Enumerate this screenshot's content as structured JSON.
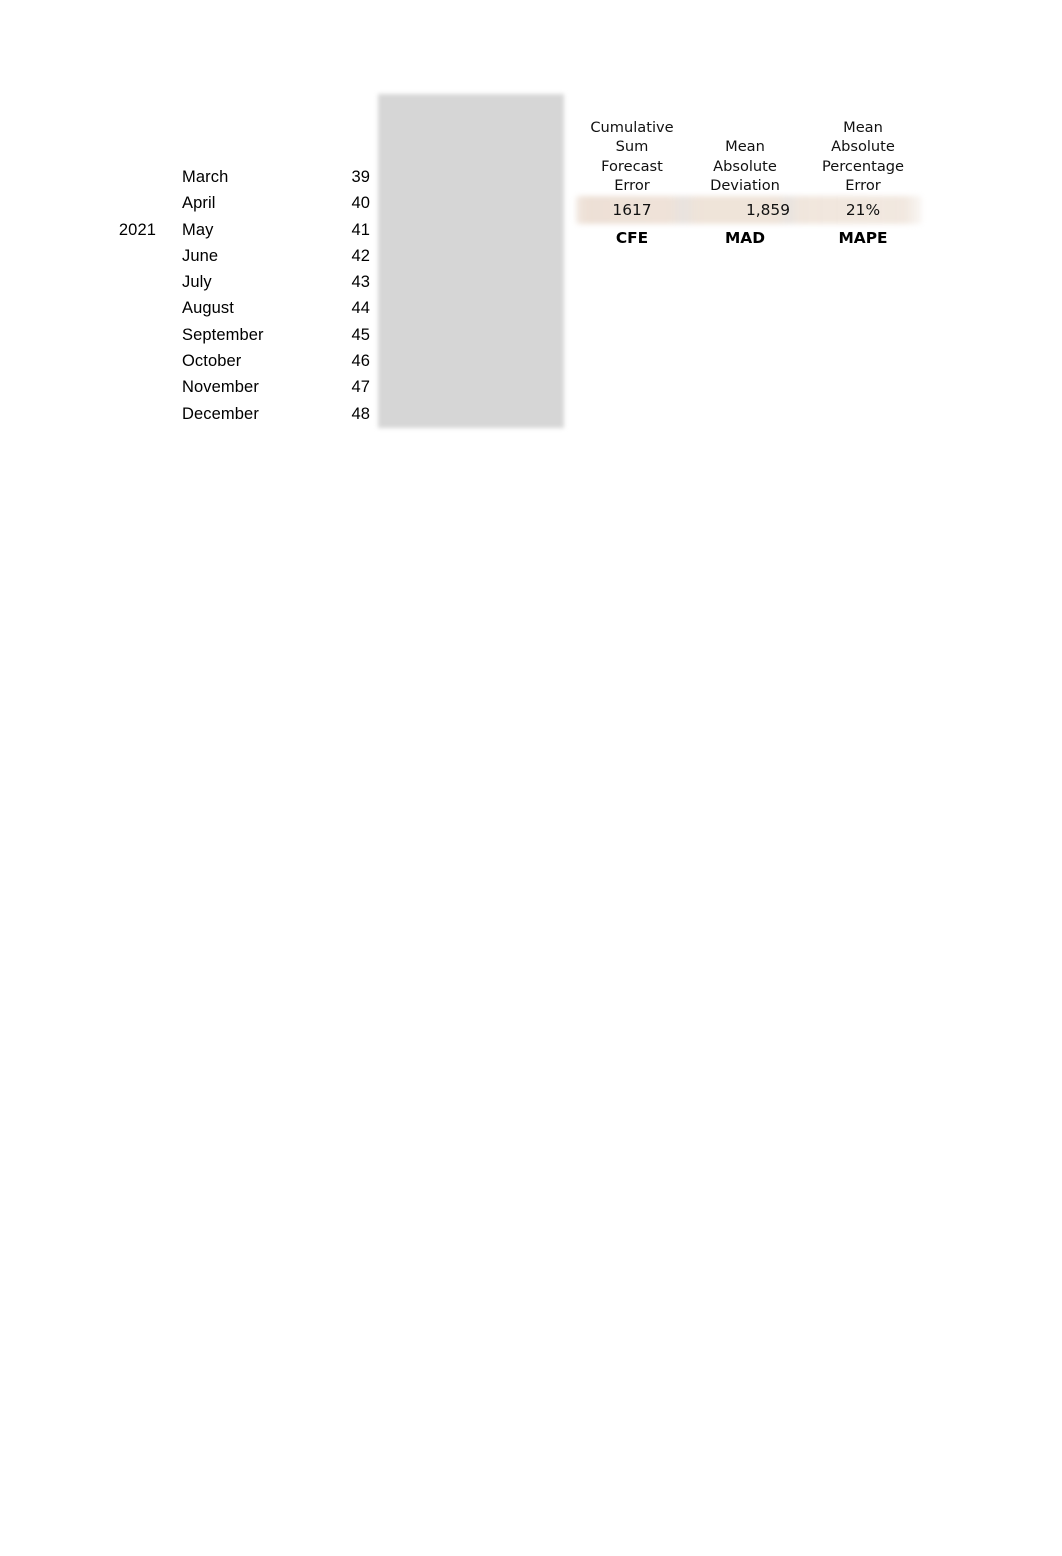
{
  "colors": {
    "background": "#ffffff",
    "gray_block": "#d6d6d6",
    "highlight_band": "#eee2d7",
    "text": "#000000"
  },
  "month_table": {
    "year_label": "2021",
    "year_row_index": 2,
    "rows": [
      {
        "month": "March",
        "value": "39"
      },
      {
        "month": "April",
        "value": "40"
      },
      {
        "month": "May",
        "value": "41"
      },
      {
        "month": "June",
        "value": "42"
      },
      {
        "month": "July",
        "value": "43"
      },
      {
        "month": "August",
        "value": "44"
      },
      {
        "month": "September",
        "value": "45"
      },
      {
        "month": "October",
        "value": "46"
      },
      {
        "month": "November",
        "value": "47"
      },
      {
        "month": "December",
        "value": "48"
      }
    ]
  },
  "metrics": {
    "columns": [
      {
        "header_lines": [
          "Cumulative",
          "Sum",
          "Forecast",
          "Error"
        ],
        "header_text": "Cumulative Sum Forecast Error",
        "value": "1617",
        "abbr": "CFE",
        "align": "center"
      },
      {
        "header_lines": [
          "Mean",
          "Absolute",
          "Deviation"
        ],
        "header_text": "Mean Absolute Deviation",
        "value": "1,859",
        "abbr": "MAD",
        "align": "right"
      },
      {
        "header_lines": [
          "Mean",
          "Absolute",
          "Percentage",
          "Error"
        ],
        "header_text": "Mean Absolute Percentage Error",
        "value": "21%",
        "abbr": "MAPE",
        "align": "center"
      }
    ]
  }
}
